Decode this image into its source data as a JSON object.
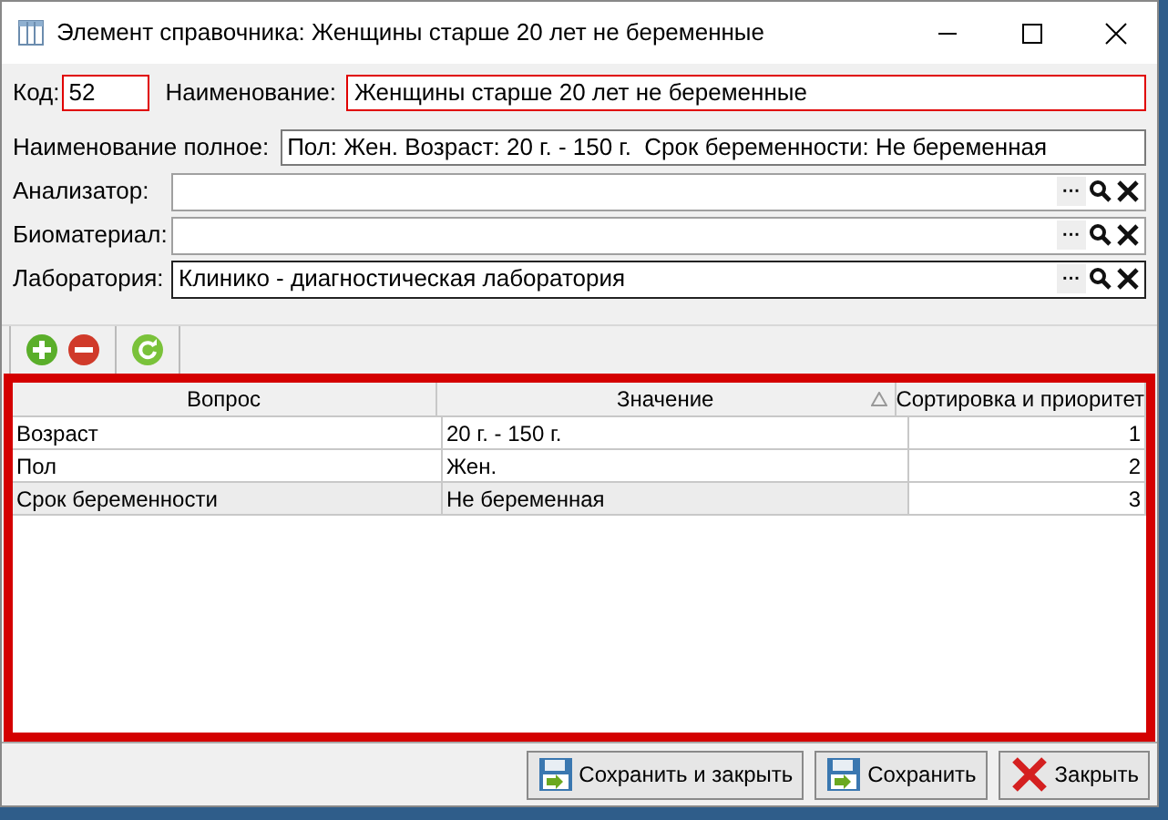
{
  "window": {
    "title": "Элемент справочника: Женщины старше 20 лет не беременные"
  },
  "code": {
    "label": "Код:",
    "value": "52",
    "invalid": true
  },
  "name": {
    "label": "Наименование:",
    "value": "Женщины старше 20 лет не беременные",
    "invalid": true
  },
  "full_name": {
    "label": "Наименование полное:",
    "value": "Пол: Жен. Возраст: 20 г. - 150 г.  Срок беременности: Не беременная"
  },
  "lookups": [
    {
      "label": "Анализатор:",
      "focused": false
    },
    {
      "label": "Биоматериал:",
      "focused": false
    },
    {
      "label": "Лаборатория:",
      "value": "Клинико - диагностическая лаборатория",
      "focused": true
    }
  ],
  "lookup_buttons": [
    "···"
  ],
  "table": {
    "columns": [
      {
        "title": "Вопрос",
        "sorted": false
      },
      {
        "title": "Значение",
        "sorted": true
      },
      {
        "title": "Сортировка и приоритет",
        "sorted": false
      }
    ],
    "rows": [
      {
        "cells": [
          "Возраст",
          "20 г. - 150 г.",
          "1"
        ],
        "selected": false
      },
      {
        "cells": [
          "Пол",
          "Жен.",
          "2"
        ],
        "selected": false
      },
      {
        "cells": [
          "Срок беременности",
          "Не беременная",
          "3"
        ],
        "selected": true
      }
    ]
  },
  "buttons": [
    {
      "kind": "save",
      "label": "Сохранить и закрыть"
    },
    {
      "kind": "save",
      "label": "Сохранить"
    },
    {
      "kind": "close",
      "label": "Закрыть"
    }
  ]
}
